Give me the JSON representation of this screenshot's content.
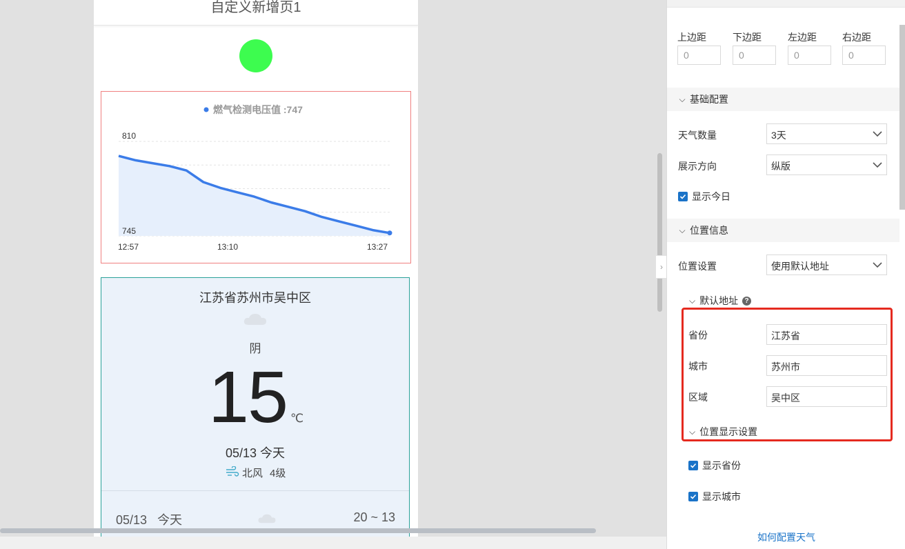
{
  "canvas": {
    "page_title": "自定义新增页1",
    "status_indicator_color": "#3dfc4f"
  },
  "chart_data": {
    "type": "area",
    "legend": "燃气检测电压值 :747",
    "series": [
      {
        "name": "燃气检测电压值",
        "color": "#3b7ce8"
      }
    ],
    "x": [
      "12:57",
      "12:59",
      "13:01",
      "13:03",
      "13:05",
      "13:07",
      "13:08",
      "13:10",
      "13:12",
      "13:14",
      "13:16",
      "13:18",
      "13:20",
      "13:22",
      "13:24",
      "13:26",
      "13:27"
    ],
    "values": [
      800,
      797,
      795,
      793,
      790,
      782,
      778,
      775,
      772,
      768,
      765,
      762,
      758,
      755,
      752,
      749,
      747
    ],
    "x_tick_labels": [
      "12:57",
      "13:10",
      "13:27"
    ],
    "y_tick_labels": [
      "810",
      "745"
    ],
    "ylim": [
      745,
      810
    ],
    "grid": "horizontal-dashed"
  },
  "weather": {
    "location": "江苏省苏州市吴中区",
    "condition": "阴",
    "temperature": "15",
    "unit": "℃",
    "date": "05/13 今天",
    "wind": "北风",
    "wind_level": "4级",
    "forecast_date": "05/13",
    "forecast_day": "今天",
    "forecast_range": "20 ~ 13"
  },
  "panel": {
    "padding": {
      "top_label": "上边距",
      "top_value": "0",
      "bottom_label": "下边距",
      "bottom_value": "0",
      "left_label": "左边距",
      "left_value": "0",
      "right_label": "右边距",
      "right_value": "0"
    },
    "basic": {
      "title": "基础配置",
      "weather_count_label": "天气数量",
      "weather_count_value": "3天",
      "direction_label": "展示方向",
      "direction_value": "纵版",
      "show_today_label": "显示今日"
    },
    "location": {
      "title": "位置信息",
      "setting_label": "位置设置",
      "setting_value": "使用默认地址",
      "default_address_title": "默认地址",
      "province_label": "省份",
      "province_value": "江苏省",
      "city_label": "城市",
      "city_value": "苏州市",
      "district_label": "区域",
      "district_value": "吴中区",
      "display_title": "位置显示设置",
      "show_province_label": "显示省份",
      "show_city_label": "显示城市"
    },
    "help_link": "如何配置天气"
  }
}
